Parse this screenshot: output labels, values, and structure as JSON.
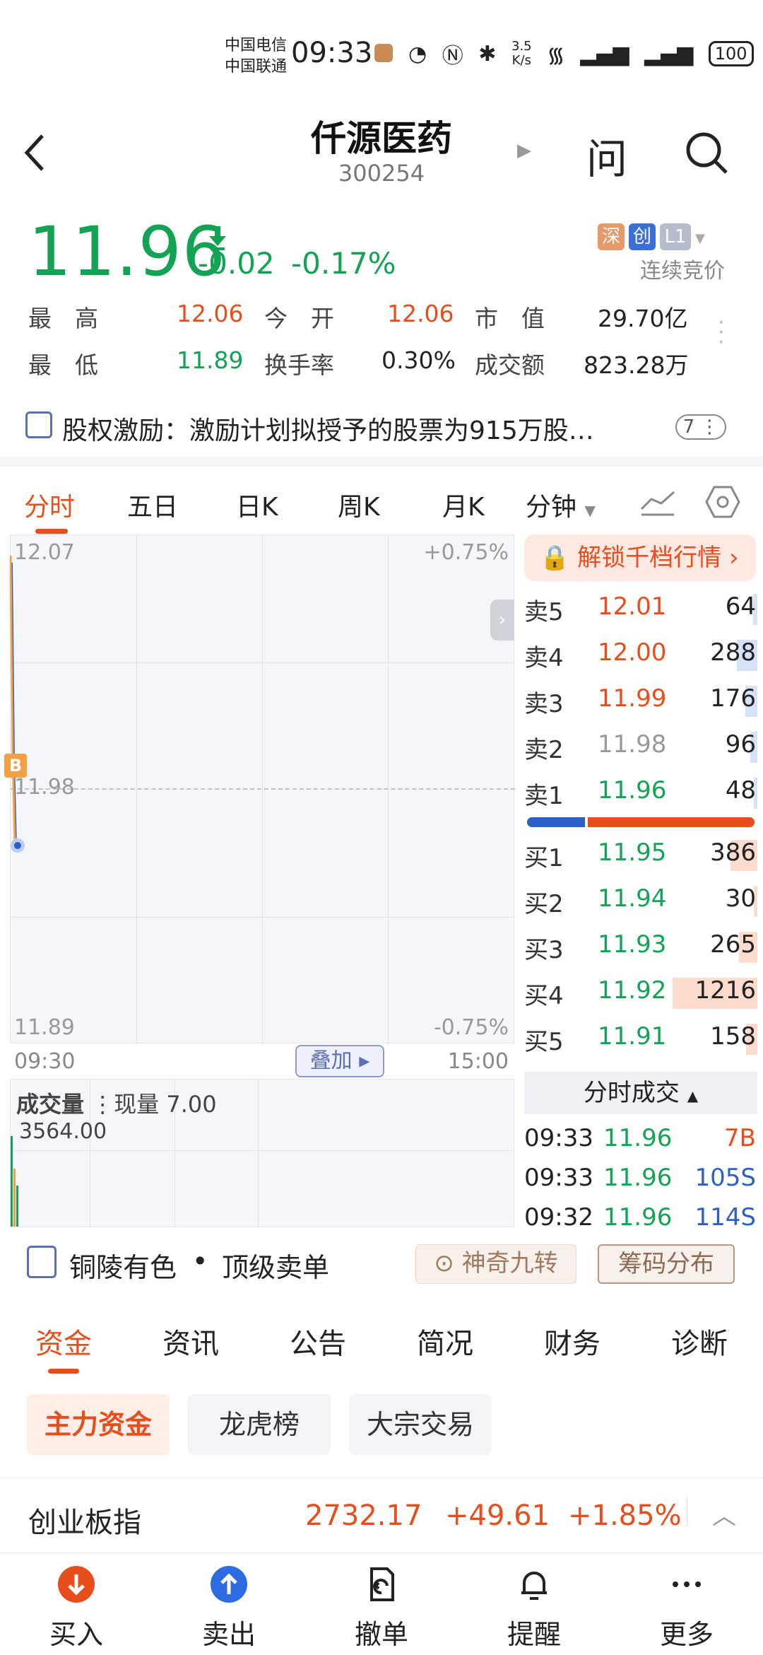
{
  "status_bar": {
    "carrier1": "中国电信",
    "carrier2": "中国联通",
    "time": "09:33",
    "net_speed_value": "3.5",
    "net_speed_unit": "K/s",
    "battery": "100"
  },
  "header": {
    "title": "仟源医药",
    "code": "300254",
    "ask_label": "问"
  },
  "quote": {
    "price": "11.96",
    "change": "-0.02",
    "change_pct": "-0.17%",
    "badges": [
      "深",
      "创",
      "L1"
    ],
    "auction_label": "连续竞价",
    "high_label": "最　高",
    "high": "12.06",
    "open_label": "今　开",
    "open": "12.06",
    "mcap_label": "市　值",
    "mcap": "29.70亿",
    "low_label": "最　低",
    "low": "11.89",
    "turnover_label": "换手率",
    "turnover": "0.30%",
    "amount_label": "成交额",
    "amount": "823.28万"
  },
  "notice": {
    "label": "股权激励：",
    "text": "激励计划拟授予的股票为915万股…",
    "count": "7"
  },
  "chart_tabs": [
    "分时",
    "五日",
    "日K",
    "周K",
    "月K",
    "分钟"
  ],
  "chart": {
    "y_top": "12.07",
    "y_mid": "11.98",
    "y_bottom": "11.89",
    "pct_top": "+0.75%",
    "pct_bottom": "-0.75%",
    "t_start": "09:30",
    "t_end": "15:00",
    "overlay": "叠加",
    "buy_marker": "B",
    "volume_label": "成交量",
    "current_volume_label": "现量 7.00",
    "volume_max": "3564.00"
  },
  "chart_data": {
    "type": "line",
    "x": [
      "09:30",
      "09:31",
      "09:32",
      "09:33"
    ],
    "y": [
      12.06,
      11.99,
      11.96,
      11.96
    ],
    "ylim": [
      11.89,
      12.07
    ],
    "reference": 11.98
  },
  "unlock_label": "解锁千档行情",
  "order_book": {
    "asks": [
      {
        "label": "卖5",
        "price": "12.01",
        "volume": "64",
        "fill": 0.05
      },
      {
        "label": "卖4",
        "price": "12.00",
        "volume": "288",
        "fill": 0.24
      },
      {
        "label": "卖3",
        "price": "11.99",
        "volume": "176",
        "fill": 0.14
      },
      {
        "label": "卖2",
        "price": "11.98",
        "volume": "96",
        "fill": 0.08
      },
      {
        "label": "卖1",
        "price": "11.96",
        "volume": "48",
        "fill": 0.04
      }
    ],
    "bids": [
      {
        "label": "买1",
        "price": "11.95",
        "volume": "386",
        "fill": 0.32
      },
      {
        "label": "买2",
        "price": "11.94",
        "volume": "30",
        "fill": 0.02
      },
      {
        "label": "买3",
        "price": "11.93",
        "volume": "265",
        "fill": 0.22
      },
      {
        "label": "买4",
        "price": "11.92",
        "volume": "1216",
        "fill": 1.0
      },
      {
        "label": "买5",
        "price": "11.91",
        "volume": "158",
        "fill": 0.13
      }
    ],
    "buy_ratio": 0.26
  },
  "ticks": {
    "header": "分时成交",
    "rows": [
      {
        "time": "09:33",
        "price": "11.96",
        "vol": "7B"
      },
      {
        "time": "09:33",
        "price": "11.96",
        "vol": "105S"
      },
      {
        "time": "09:32",
        "price": "11.96",
        "vol": "114S"
      }
    ]
  },
  "related": {
    "name": "铜陵有色",
    "dot": "•",
    "tag": "顶级卖单",
    "magic": "神奇九转",
    "chips": "筹码分布"
  },
  "section_tabs": [
    "资金",
    "资讯",
    "公告",
    "简况",
    "财务",
    "诊断"
  ],
  "sub_tabs": [
    "主力资金",
    "龙虎榜",
    "大宗交易"
  ],
  "index_bar": {
    "name": "创业板指",
    "value": "2732.17",
    "change": "+49.61",
    "pct": "+1.85%"
  },
  "bottom_nav": [
    {
      "label": "买入",
      "icon": "buy-icon"
    },
    {
      "label": "卖出",
      "icon": "sell-icon"
    },
    {
      "label": "撤单",
      "icon": "cancel-order-icon"
    },
    {
      "label": "提醒",
      "icon": "bell-icon"
    },
    {
      "label": "更多",
      "icon": "more-icon"
    }
  ],
  "colors": {
    "up": "#e84d1c",
    "down": "#13a354",
    "accent": "#e84d1c",
    "blue": "#2d5fc8"
  }
}
